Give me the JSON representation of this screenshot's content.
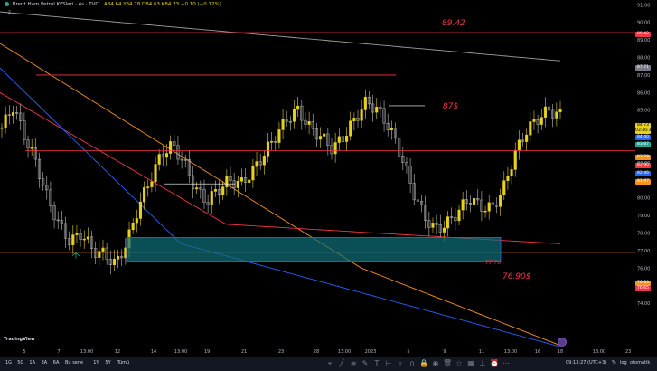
{
  "header": {
    "title": "Brent Ham Petrol KFSleri · 4s · TVC",
    "ohlc": "A84.64  Y84.78  D84.63  K84.73  −0.10 (−0.12%)",
    "sub": "∼ 2"
  },
  "annotations": {
    "top_level": "89.42",
    "resist": "87$",
    "zone_high": "77.70",
    "support": "76.90$"
  },
  "price_axis": [
    "91.00",
    "90.00",
    "89.00",
    "88.00",
    "87.00",
    "86.00",
    "85.00",
    "84.00",
    "83.00",
    "82.00",
    "81.00",
    "80.00",
    "79.00",
    "78.00",
    "77.00",
    "76.00",
    "75.00",
    "74.00"
  ],
  "price_tags": [
    {
      "label": "89.42",
      "color": "#f23645"
    },
    {
      "label": "87.71",
      "color": "#787b86"
    },
    {
      "label": "84.73",
      "color": "#e6d11b"
    },
    {
      "label": "03:46:32",
      "color": "#e6d11b"
    },
    {
      "label": "84.40",
      "color": "#2962ff"
    },
    {
      "label": "83.87",
      "color": "#26a69a"
    },
    {
      "label": "83.28",
      "color": "#f7931a"
    },
    {
      "label": "82.90",
      "color": "#f23645"
    },
    {
      "label": "82.46",
      "color": "#2962ff"
    },
    {
      "label": "81.97",
      "color": "#f7931a"
    },
    {
      "label": "76.90",
      "color": "#f7931a"
    },
    {
      "label": "76.65",
      "color": "#f23645"
    }
  ],
  "time_axis": [
    "5",
    "7",
    "13:00",
    "12",
    "14",
    "13:00",
    "19",
    "21",
    "23",
    "28",
    "13:00",
    "2023",
    "5",
    "9",
    "11",
    "13:00",
    "16",
    "18",
    "13:00",
    "23"
  ],
  "bottom": {
    "timeframes": [
      "1G",
      "5G",
      "1A",
      "3A",
      "6A",
      "Bu sene",
      "1Y",
      "5Y",
      "Tümü"
    ],
    "clock": "09:13:27 (UTC+3)",
    "pct": "%",
    "log": "log",
    "auto": "otomatik"
  },
  "logo": "TradingView",
  "colors": {
    "up": "#e6d11b",
    "down": "#c0c0c0",
    "red": "#f23645",
    "teal": "#26a69a",
    "zone": "#0e6f7a"
  }
}
